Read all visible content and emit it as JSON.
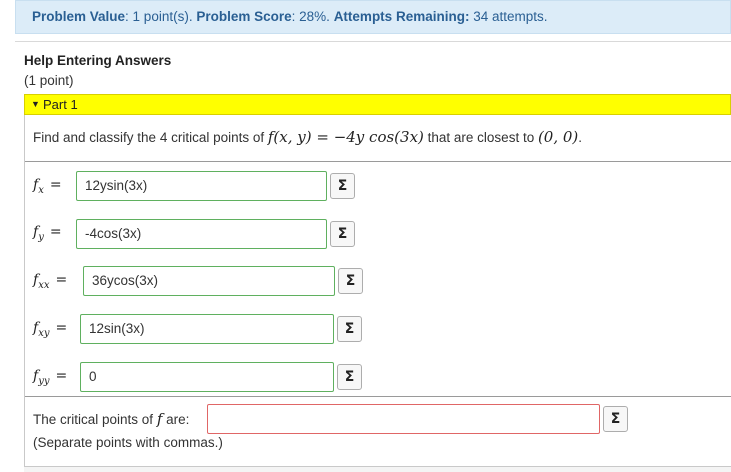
{
  "status": {
    "value_label": "Problem Value",
    "value_text": ": 1 point(s).",
    "score_label": "Problem Score",
    "score_text": ": 28%.",
    "attempts_label": "Attempts Remaining:",
    "attempts_text": " 34 attempts."
  },
  "help": {
    "title": "Help Entering Answers",
    "points": "(1 point)"
  },
  "part": {
    "label": "Part 1"
  },
  "question": {
    "prefix": "Find and classify the 4 critical points of ",
    "func_lhs": "f(x, y)",
    "func_eq": " = −4y cos(3x)",
    "middle": " that are closest to ",
    "point": "(0, 0)",
    "suffix": "."
  },
  "derivatives": [
    {
      "name": "f",
      "sub": "x",
      "value": "12ysin(3x)"
    },
    {
      "name": "f",
      "sub": "y",
      "value": "-4cos(3x)"
    },
    {
      "name": "f",
      "sub": "xx",
      "value": "36ycos(3x)"
    },
    {
      "name": "f",
      "sub": "xy",
      "value": "12sin(3x)"
    },
    {
      "name": "f",
      "sub": "yy",
      "value": "0"
    }
  ],
  "critical": {
    "label_prefix": "The critical points of ",
    "label_f": "f",
    "label_suffix": " are:",
    "value": "",
    "note": "(Separate points with commas.)"
  },
  "sigma_symbol": "Σ",
  "equals": "=",
  "colors": {
    "infobar_bg": "#dcecf8",
    "infobar_text": "#2a5f93",
    "part_header_bg": "#ffff00",
    "correct_border": "#5fb05f",
    "incorrect_border": "#e06666"
  }
}
